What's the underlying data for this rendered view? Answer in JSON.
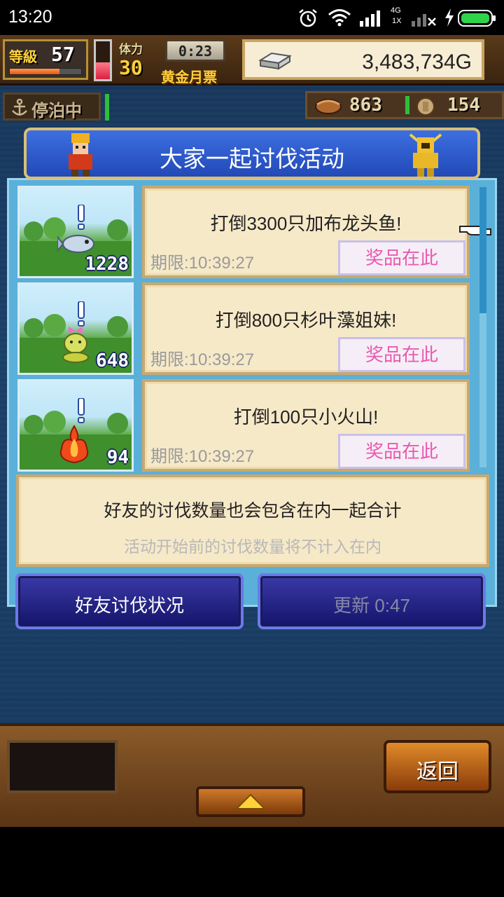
{
  "status_bar": {
    "time": "13:20",
    "network": "4G",
    "network_sub": "1X"
  },
  "hud": {
    "level_label": "等級",
    "level_value": "57",
    "level_progress": 0.7,
    "stamina_fill": 0.45,
    "stamina_label": "体力",
    "stamina_value": "30",
    "timer": "0:23",
    "gold_ticket_label": "黄金月票",
    "money": "3,483,734G",
    "docked_label": "停泊中",
    "food_count": "863",
    "coin_count": "154"
  },
  "panel": {
    "title": "大家一起讨伐活动",
    "missions": [
      {
        "kill_count": "1228",
        "text": "打倒3300只加布龙头鱼!",
        "deadline": "期限:10:39:27",
        "reward_label": "奖品在此"
      },
      {
        "kill_count": "648",
        "text": "打倒800只杉叶藻姐妹!",
        "deadline": "期限:10:39:27",
        "reward_label": "奖品在此"
      },
      {
        "kill_count": "94",
        "text": "打倒100只小火山!",
        "deadline": "期限:10:39:27",
        "reward_label": "奖品在此"
      }
    ],
    "info_main": "好友的讨伐数量也会包含在内一起合计",
    "info_sub": "活动开始前的讨伐数量将不计入在内"
  },
  "buttons": {
    "friend_status": "好友讨伐状况",
    "refresh": "更新 0:47",
    "back": "返回"
  },
  "colors": {
    "panel_blue": "#5ab0d8",
    "title_blue": "#2249b8",
    "reward_pink": "#e85ab0",
    "card_cream": "#f6e9c8"
  }
}
